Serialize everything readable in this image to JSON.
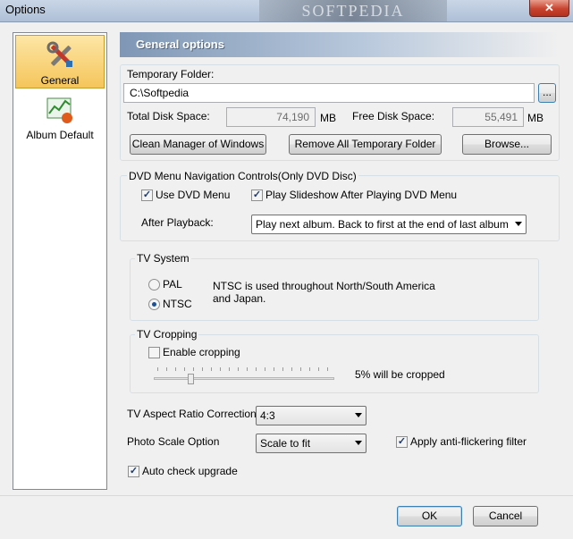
{
  "window": {
    "title": "Options",
    "watermark": "SOFTPEDIA",
    "close_glyph": "✕"
  },
  "sidebar": {
    "items": [
      {
        "label": "General",
        "icon": "tools-icon",
        "selected": true
      },
      {
        "label": "Album Default",
        "icon": "chart-icon",
        "selected": false
      }
    ]
  },
  "header": {
    "title": "General options"
  },
  "temp_folder": {
    "label": "Temporary Folder:",
    "path": "C:\\Softpedia",
    "browse_dots": "...",
    "total_label": "Total Disk Space:",
    "total_value": "74,190",
    "total_unit": "MB",
    "free_label": "Free Disk Space:",
    "free_value": "55,491",
    "free_unit": "MB",
    "clean_button": "Clean Manager of Windows",
    "remove_button": "Remove All Temporary Folder",
    "browse_button": "Browse..."
  },
  "dvd_menu": {
    "label": "DVD Menu Navigation Controls(Only DVD Disc)",
    "use_dvd_menu": {
      "label": "Use DVD Menu",
      "checked": true
    },
    "play_slideshow": {
      "label": "Play Slideshow After Playing DVD Menu",
      "checked": true
    },
    "after_playback_label": "After Playback:",
    "after_playback_value": "Play next album. Back to first at the end of last album"
  },
  "tv_system": {
    "label": "TV System",
    "pal": "PAL",
    "ntsc": "NTSC",
    "selected": "NTSC",
    "description": "NTSC is used throughout North/South America and Japan."
  },
  "tv_cropping": {
    "label": "TV Cropping",
    "enable_label": "Enable cropping",
    "enabled": false,
    "crop_text": "5% will be cropped",
    "slider_value_percent": 5
  },
  "aspect": {
    "label": "TV Aspect Ratio Correction",
    "value": "4:3"
  },
  "photo_scale": {
    "label": "Photo Scale Option",
    "value": "Scale to fit"
  },
  "anti_flicker": {
    "label": "Apply anti-flickering filter",
    "checked": true
  },
  "auto_upgrade": {
    "label": "Auto check upgrade",
    "checked": true
  },
  "footer": {
    "ok": "OK",
    "cancel": "Cancel"
  },
  "check_glyph": "✓"
}
